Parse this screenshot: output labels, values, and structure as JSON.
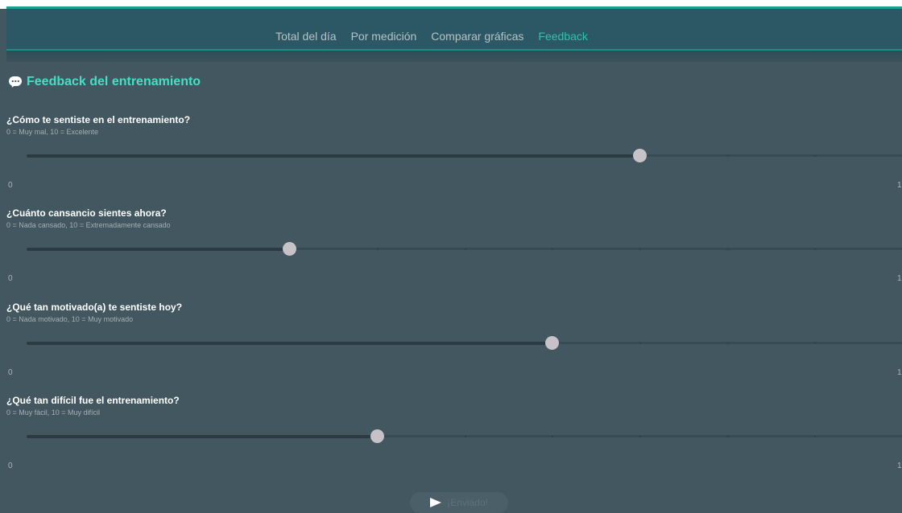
{
  "nav": {
    "tabs": [
      {
        "label": "Total del día",
        "active": false
      },
      {
        "label": "Por medición",
        "active": false
      },
      {
        "label": "Comparar gráficas",
        "active": false
      },
      {
        "label": "Feedback",
        "active": true
      }
    ]
  },
  "feedback": {
    "icon": "chat-bubble-icon",
    "title": "Feedback del entrenamiento",
    "questions": [
      {
        "label": "¿Cómo te sentiste en el entrenamiento?",
        "hint": "0 = Muy mal, 10 = Excelente",
        "value": 7,
        "min": 0,
        "max": 10,
        "min_label": "0",
        "max_label": "1"
      },
      {
        "label": "¿Cuánto cansancio sientes ahora?",
        "hint": "0 = Nada cansado, 10 = Extremadamente cansado",
        "value": 3,
        "min": 0,
        "max": 10,
        "min_label": "0",
        "max_label": "1"
      },
      {
        "label": "¿Qué tan motivado(a) te sentiste hoy?",
        "hint": "0 = Nada motivado, 10 = Muy motivado",
        "value": 6,
        "min": 0,
        "max": 10,
        "min_label": "0",
        "max_label": "1"
      },
      {
        "label": "¿Qué tan difícil fue el entrenamiento?",
        "hint": "0 = Muy fácil, 10 = Muy difícil",
        "value": 4,
        "min": 0,
        "max": 10,
        "min_label": "0",
        "max_label": "1"
      }
    ],
    "submit_label": "¡Enviado!",
    "submit_icon": "send-icon"
  },
  "colors": {
    "accent": "#2cc4aa",
    "title": "#43e0c4",
    "background": "#425760",
    "navbar": "#2c5866",
    "thumb": "#c6c2c8"
  }
}
